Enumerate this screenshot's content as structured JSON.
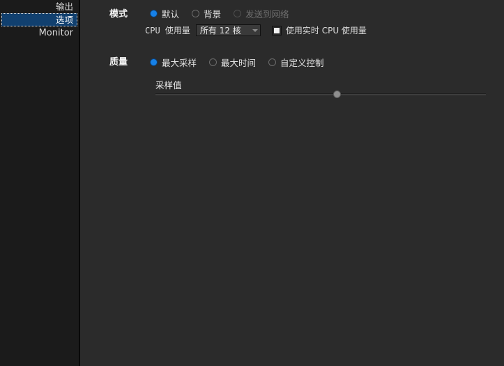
{
  "sidebar": {
    "items": [
      {
        "label": "输出",
        "selected": false
      },
      {
        "label": "选项",
        "selected": true
      },
      {
        "label": "Monitor",
        "selected": false
      }
    ]
  },
  "panel": {
    "mode": {
      "group_label": "模式",
      "options": [
        {
          "label": "默认",
          "state": "selected"
        },
        {
          "label": "背景",
          "state": "normal"
        },
        {
          "label": "发送到网络",
          "state": "disabled"
        }
      ],
      "cpu_usage_label": "CPU 使用量",
      "cpu_dropdown_value": "所有 12 核",
      "realtime_checkbox_label": "使用实时 CPU 使用量",
      "realtime_checkbox_checked": false
    },
    "quality": {
      "group_label": "质量",
      "options": [
        {
          "label": "最大采样",
          "state": "selected"
        },
        {
          "label": "最大时间",
          "state": "normal"
        },
        {
          "label": "自定义控制",
          "state": "normal"
        }
      ],
      "slider": {
        "label": "采样值",
        "value": "400",
        "percent": 55
      }
    }
  },
  "colors": {
    "accent_blue": "#1681e8",
    "selection_blue": "#11406f",
    "panel_bg": "#2b2b2b",
    "sidebar_bg": "#1b1b1b"
  }
}
